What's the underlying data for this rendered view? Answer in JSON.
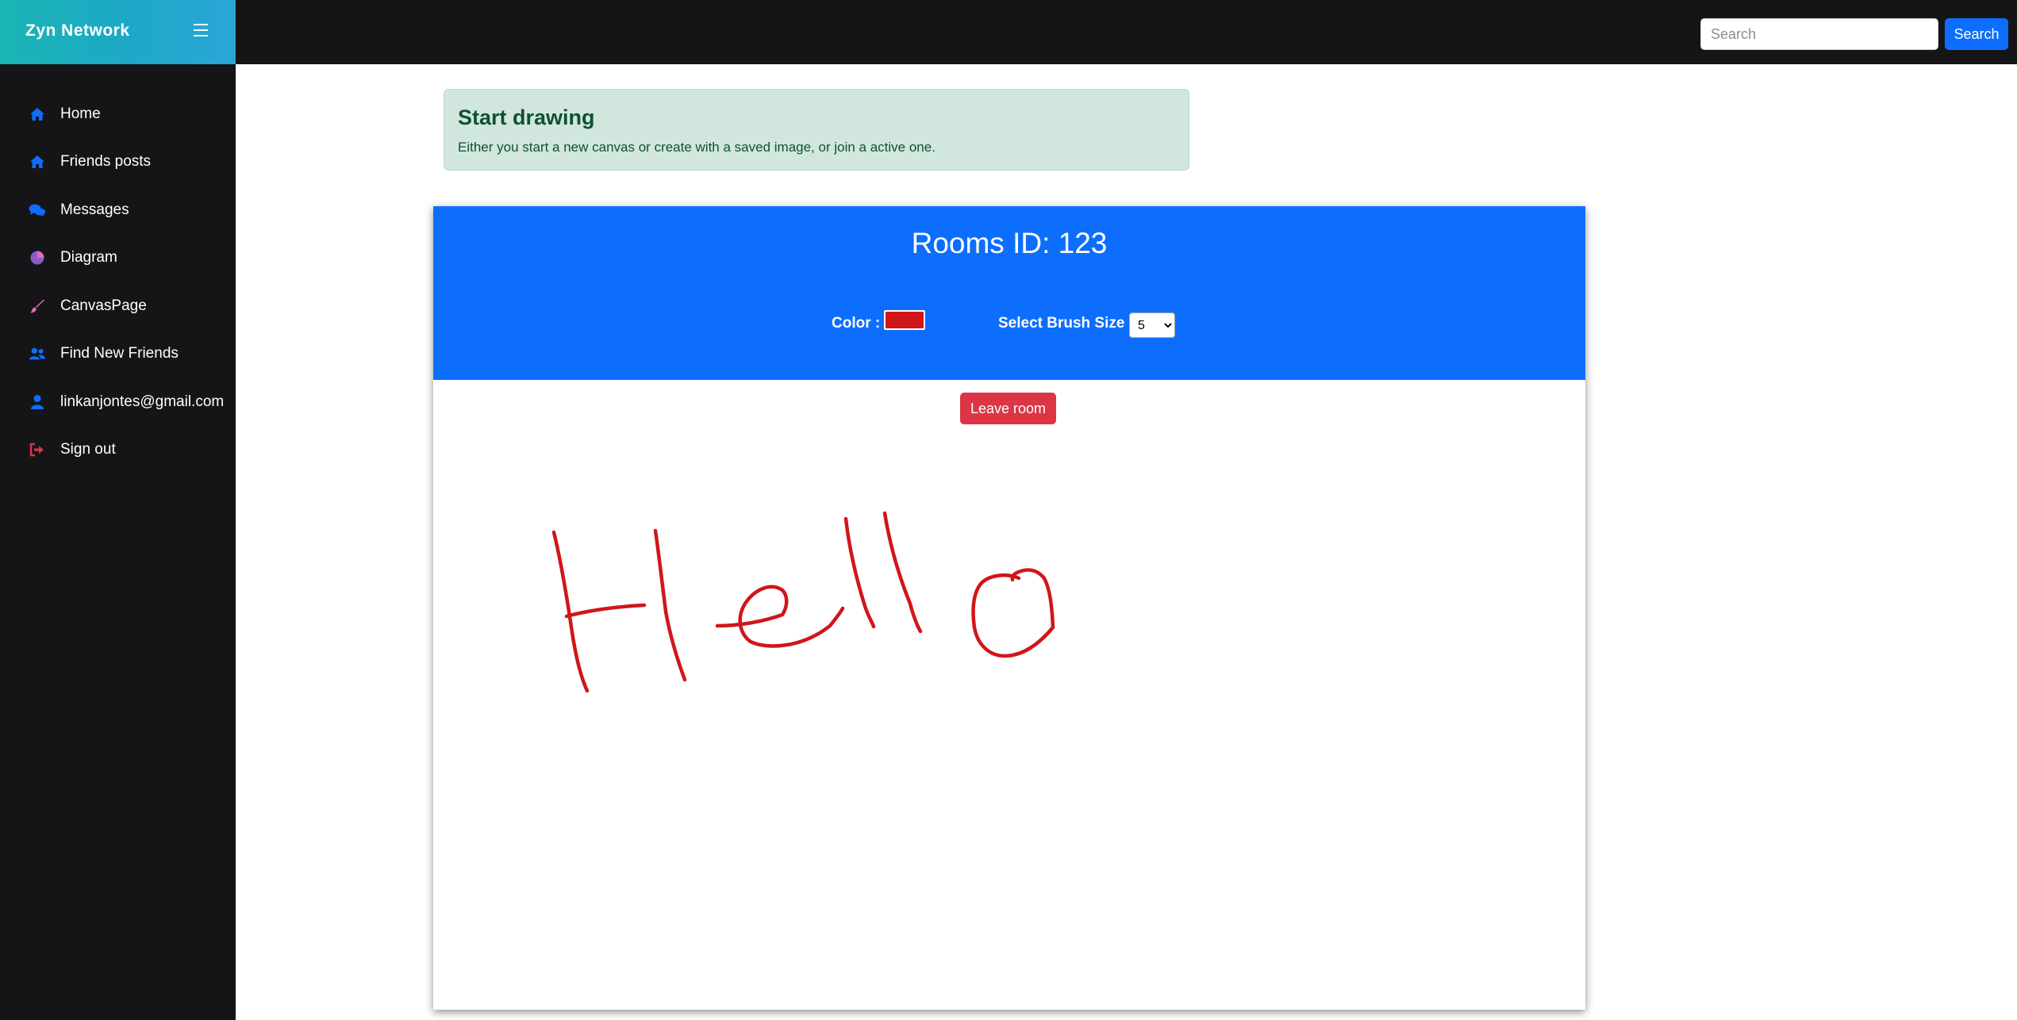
{
  "brand": {
    "name": "Zyn Network",
    "gradient_from": "#19b5b2",
    "gradient_to": "#2aa6d6"
  },
  "sidebar": {
    "items": [
      {
        "label": "Home",
        "icon": "home-icon"
      },
      {
        "label": "Friends posts",
        "icon": "home-icon"
      },
      {
        "label": "Messages",
        "icon": "comments-icon"
      },
      {
        "label": "Diagram",
        "icon": "pie-chart-icon"
      },
      {
        "label": "CanvasPage",
        "icon": "paint-brush-icon"
      },
      {
        "label": "Find New Friends",
        "icon": "users-icon"
      },
      {
        "label": "linkanjontes@gmail.com",
        "icon": "user-icon"
      },
      {
        "label": "Sign out",
        "icon": "sign-out-icon"
      }
    ]
  },
  "topbar": {
    "search_placeholder": "Search",
    "search_button_label": "Search"
  },
  "alert": {
    "title": "Start drawing",
    "text": "Either you start a new canvas or create with a saved image, or join a active one."
  },
  "room": {
    "title": "Rooms ID: 123",
    "color_label": "Color :",
    "brush_label": "Select Brush Size :",
    "brush_size": "5",
    "selected_color": "#d0161b",
    "leave_button_label": "Leave room"
  },
  "colors": {
    "primary": "#0d6efd",
    "danger": "#dc3545",
    "sidebar_bg": "#151518",
    "icon_blue": "#0d6efd",
    "icon_purple": "#8e5ac8",
    "icon_pink": "#e56bb4",
    "stroke": "#d0161b"
  },
  "canvas": {
    "stroke_color": "#d0161b"
  }
}
